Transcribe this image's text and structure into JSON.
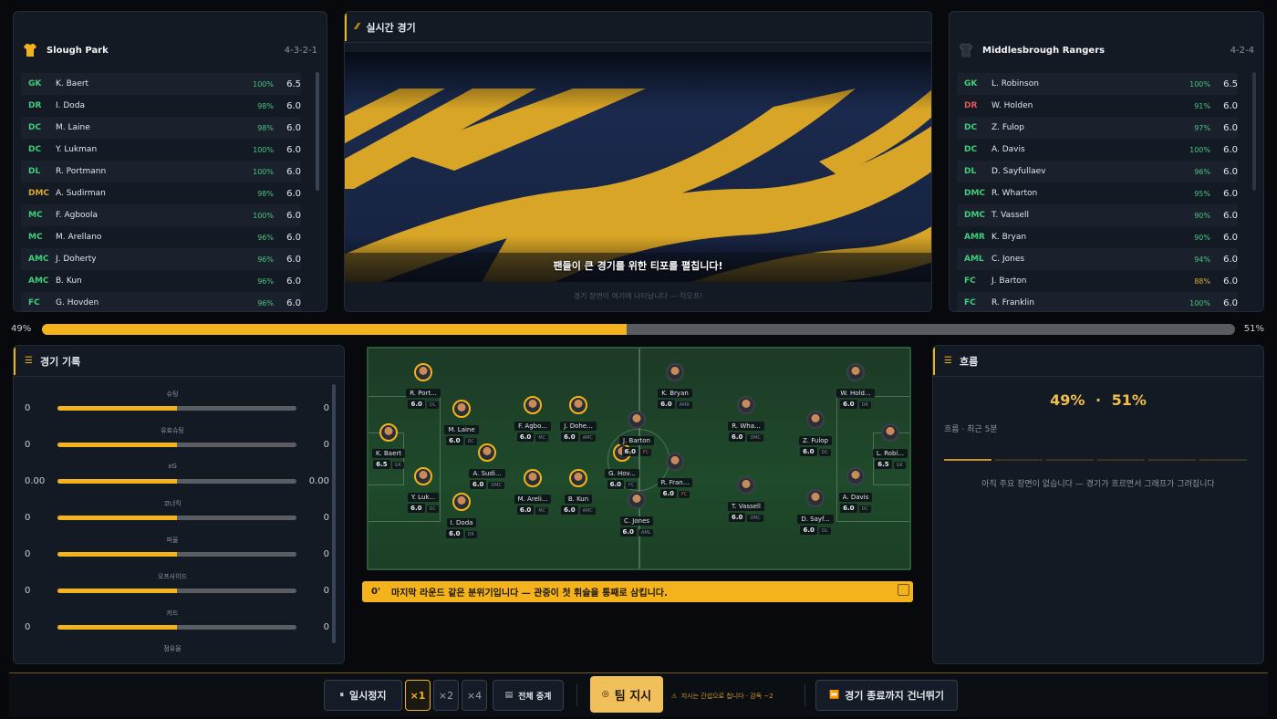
{
  "home": {
    "name": "Slough Park",
    "formation": "4-3-2-1",
    "players": [
      {
        "pos": "GK",
        "name": "K. Baert",
        "cond": "100%",
        "rating": "6.5",
        "pos_color": "#3ecf7a"
      },
      {
        "pos": "DR",
        "name": "I. Doda",
        "cond": "98%",
        "rating": "6.0",
        "pos_color": "#3ecf7a"
      },
      {
        "pos": "DC",
        "name": "M. Laine",
        "cond": "98%",
        "rating": "6.0",
        "pos_color": "#3ecf7a"
      },
      {
        "pos": "DC",
        "name": "Y. Lukman",
        "cond": "100%",
        "rating": "6.0",
        "pos_color": "#3ecf7a"
      },
      {
        "pos": "DL",
        "name": "R. Portmann",
        "cond": "100%",
        "rating": "6.0",
        "pos_color": "#3ecf7a"
      },
      {
        "pos": "DMC",
        "name": "A. Sudirman",
        "cond": "98%",
        "rating": "6.0",
        "pos_color": "#e0a830"
      },
      {
        "pos": "MC",
        "name": "F. Agboola",
        "cond": "100%",
        "rating": "6.0",
        "pos_color": "#3ecf7a"
      },
      {
        "pos": "MC",
        "name": "M. Arellano",
        "cond": "96%",
        "rating": "6.0",
        "pos_color": "#3ecf7a"
      },
      {
        "pos": "AMC",
        "name": "J. Doherty",
        "cond": "96%",
        "rating": "6.0",
        "pos_color": "#3ecf7a"
      },
      {
        "pos": "AMC",
        "name": "B. Kun",
        "cond": "96%",
        "rating": "6.0",
        "pos_color": "#3ecf7a"
      },
      {
        "pos": "FC",
        "name": "G. Hovden",
        "cond": "96%",
        "rating": "6.0",
        "pos_color": "#3ecf7a"
      }
    ]
  },
  "away": {
    "name": "Middlesbrough Rangers",
    "formation": "4-2-4",
    "players": [
      {
        "pos": "GK",
        "name": "L. Robinson",
        "cond": "100%",
        "rating": "6.5",
        "pos_color": "#3ecf7a",
        "cond_color": "#47c77a"
      },
      {
        "pos": "DR",
        "name": "W. Holden",
        "cond": "91%",
        "rating": "6.0",
        "pos_color": "#e05858",
        "cond_color": "#47c77a"
      },
      {
        "pos": "DC",
        "name": "Z. Fulop",
        "cond": "97%",
        "rating": "6.0",
        "pos_color": "#3ecf7a",
        "cond_color": "#47c77a"
      },
      {
        "pos": "DC",
        "name": "A. Davis",
        "cond": "100%",
        "rating": "6.0",
        "pos_color": "#3ecf7a",
        "cond_color": "#47c77a"
      },
      {
        "pos": "DL",
        "name": "D. Sayfullaev",
        "cond": "96%",
        "rating": "6.0",
        "pos_color": "#3ecf7a",
        "cond_color": "#47c77a"
      },
      {
        "pos": "DMC",
        "name": "R. Wharton",
        "cond": "95%",
        "rating": "6.0",
        "pos_color": "#3ecf7a",
        "cond_color": "#47c77a"
      },
      {
        "pos": "DMC",
        "name": "T. Vassell",
        "cond": "90%",
        "rating": "6.0",
        "pos_color": "#3ecf7a",
        "cond_color": "#47c77a"
      },
      {
        "pos": "AMR",
        "name": "K. Bryan",
        "cond": "90%",
        "rating": "6.0",
        "pos_color": "#3ecf7a",
        "cond_color": "#47c77a"
      },
      {
        "pos": "AML",
        "name": "C. Jones",
        "cond": "94%",
        "rating": "6.0",
        "pos_color": "#3ecf7a",
        "cond_color": "#47c77a"
      },
      {
        "pos": "FC",
        "name": "J. Barton",
        "cond": "88%",
        "rating": "6.0",
        "pos_color": "#3ecf7a",
        "cond_color": "#d8a83a"
      },
      {
        "pos": "FC",
        "name": "R. Franklin",
        "cond": "100%",
        "rating": "6.0",
        "pos_color": "#3ecf7a",
        "cond_color": "#47c77a"
      }
    ]
  },
  "live": {
    "title": "실시간 경기",
    "caption": "팬들이 큰 경기를 위한 티포를 펼칩니다!",
    "footer": "경기 장면이 여기에 나타납니다 — 킥오프!"
  },
  "possession": {
    "home_label": "49%",
    "away_label": "51%",
    "home_fraction": 0.49
  },
  "stats": {
    "title": "경기 기록",
    "rows": [
      {
        "label": "슈팅",
        "home": "0",
        "away": "0",
        "home_fraction": 0.5
      },
      {
        "label": "유효슈팅",
        "home": "0",
        "away": "0",
        "home_fraction": 0.5
      },
      {
        "label": "xG",
        "home": "0.00",
        "away": "0.00",
        "home_fraction": 0.5
      },
      {
        "label": "코너킥",
        "home": "0",
        "away": "0",
        "home_fraction": 0.5
      },
      {
        "label": "파울",
        "home": "0",
        "away": "0",
        "home_fraction": 0.5
      },
      {
        "label": "오프사이드",
        "home": "0",
        "away": "0",
        "home_fraction": 0.5
      },
      {
        "label": "카드",
        "home": "0",
        "away": "0",
        "home_fraction": 0.5
      }
    ],
    "last_label": "점유율"
  },
  "pitch": {
    "home_players": [
      {
        "name": "K. Baert",
        "rating": "6.5",
        "pos": "GK"
      },
      {
        "name": "R. Port...",
        "rating": "6.0",
        "pos": "DL"
      },
      {
        "name": "M. Laine",
        "rating": "6.0",
        "pos": "DC"
      },
      {
        "name": "Y. Luk...",
        "rating": "6.0",
        "pos": "DC"
      },
      {
        "name": "I. Doda",
        "rating": "6.0",
        "pos": "DR"
      },
      {
        "name": "A. Sudi...",
        "rating": "6.0",
        "pos": "DMC"
      },
      {
        "name": "F. Agbo...",
        "rating": "6.0",
        "pos": "MC"
      },
      {
        "name": "M. Areli...",
        "rating": "6.0",
        "pos": "MC"
      },
      {
        "name": "J. Dohe...",
        "rating": "6.0",
        "pos": "AMC"
      },
      {
        "name": "B. Kun",
        "rating": "6.0",
        "pos": "AMC"
      },
      {
        "name": "G. Hov...",
        "rating": "6.0",
        "pos": "FC"
      }
    ],
    "away_players": [
      {
        "name": "J. Barton",
        "rating": "6.0",
        "pos": "FC"
      },
      {
        "name": "K. Bryan",
        "rating": "6.0",
        "pos": "AMR"
      },
      {
        "name": "R. Fran...",
        "rating": "6.0",
        "pos": "FC"
      },
      {
        "name": "C. Jones",
        "rating": "6.0",
        "pos": "AML"
      },
      {
        "name": "R. Wha...",
        "rating": "6.0",
        "pos": "DMC"
      },
      {
        "name": "T. Vassell",
        "rating": "6.0",
        "pos": "DMC"
      },
      {
        "name": "W. Hold...",
        "rating": "6.0",
        "pos": "DR"
      },
      {
        "name": "Z. Fulop",
        "rating": "6.0",
        "pos": "DC"
      },
      {
        "name": "A. Davis",
        "rating": "6.0",
        "pos": "DC"
      },
      {
        "name": "D. Sayf...",
        "rating": "6.0",
        "pos": "DL"
      },
      {
        "name": "L. Robi...",
        "rating": "6.5",
        "pos": "GK"
      }
    ]
  },
  "ticker": {
    "minute": "0'",
    "text": "마지막 라운드 같은 분위기입니다 — 관중이 첫 휘슬을 통째로 삼킵니다."
  },
  "flow": {
    "title": "흐름",
    "home": "49%",
    "dot": "·",
    "away": "51%",
    "subtitle": "흐름 · 최근 5분",
    "empty": "아직 주요 장면이 없습니다 — 경기가 흐르면서 그래프가 그려집니다"
  },
  "controls": {
    "pause": "일시정지",
    "speed1": "×1",
    "speed2": "×2",
    "speed4": "×4",
    "commentary": "전체 중계",
    "team_orders": "팀 지시",
    "warning": "지시는 간섭으로 칩니다 · 감독 −2",
    "skip": "경기 종료까지 건너뛰기"
  },
  "colors": {
    "accent": "#f4b31c",
    "home_shirt": "#f2b31d",
    "away_shirt": "#2b2f36"
  }
}
